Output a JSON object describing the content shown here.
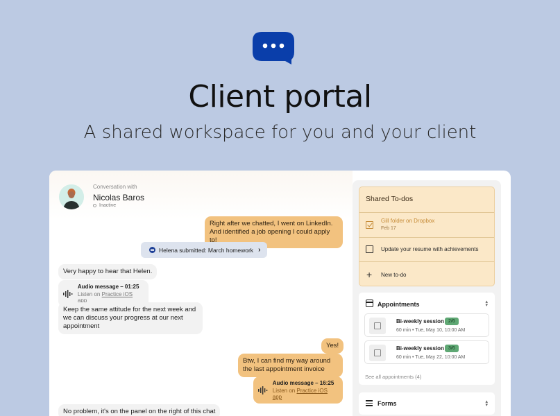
{
  "hero": {
    "title": "Client portal",
    "subtitle": "A shared workspace for you and your client",
    "icon": "chat-bubble-icon",
    "brand_color": "#0a3eaa"
  },
  "chat": {
    "header": {
      "conversation_with": "Conversation with",
      "client_name": "Nicolas Baros",
      "status": "Inactive"
    },
    "messages": {
      "m1": "Right after we chatted, I went on LinkedIn. And identified a job opening I could apply to!",
      "system": "Helena submitted: March homework",
      "m2": "Very happy to hear that Helen.",
      "audio1": {
        "title": "Audio message – 01:25",
        "listen_prefix": "Listen on",
        "link": "Practice iOS app"
      },
      "m3": "Keep the same attitude for the next week and we can discuss your progress at our next appointment",
      "m4": "Yes!",
      "m5": "Btw, I can find my way around the last appointment invoice",
      "audio2": {
        "title": "Audio message – 16:25",
        "listen_prefix": "Listen on",
        "link": "Practice iOS app"
      },
      "m6": "No problem, it's on the panel on the right of this chat"
    }
  },
  "side": {
    "todos": {
      "title": "Shared To-dos",
      "items": [
        {
          "label": "Gill folder on Dropbox",
          "date": "Feb 17",
          "done": true
        },
        {
          "label": "Update your resume with achievements",
          "done": false
        }
      ],
      "new_label": "New to-do"
    },
    "appointments": {
      "title": "Appointments",
      "items": [
        {
          "name": "Bi-weekly session",
          "badge": "2/6",
          "meta": "60 min  •  Tue, May 10, 10:00 AM"
        },
        {
          "name": "Bi-weekly session",
          "badge": "3/6",
          "meta": "60 min  •  Tue, May 22, 10:00 AM"
        }
      ],
      "see_all": "See all appointments (4)"
    },
    "forms": {
      "title": "Forms"
    }
  },
  "colors": {
    "background": "#bccae3",
    "outgoing_bubble": "#f2c27f",
    "incoming_bubble": "#f2f2f2",
    "todo_panel": "#fbe8c8",
    "badge_green": "#5fa874"
  }
}
